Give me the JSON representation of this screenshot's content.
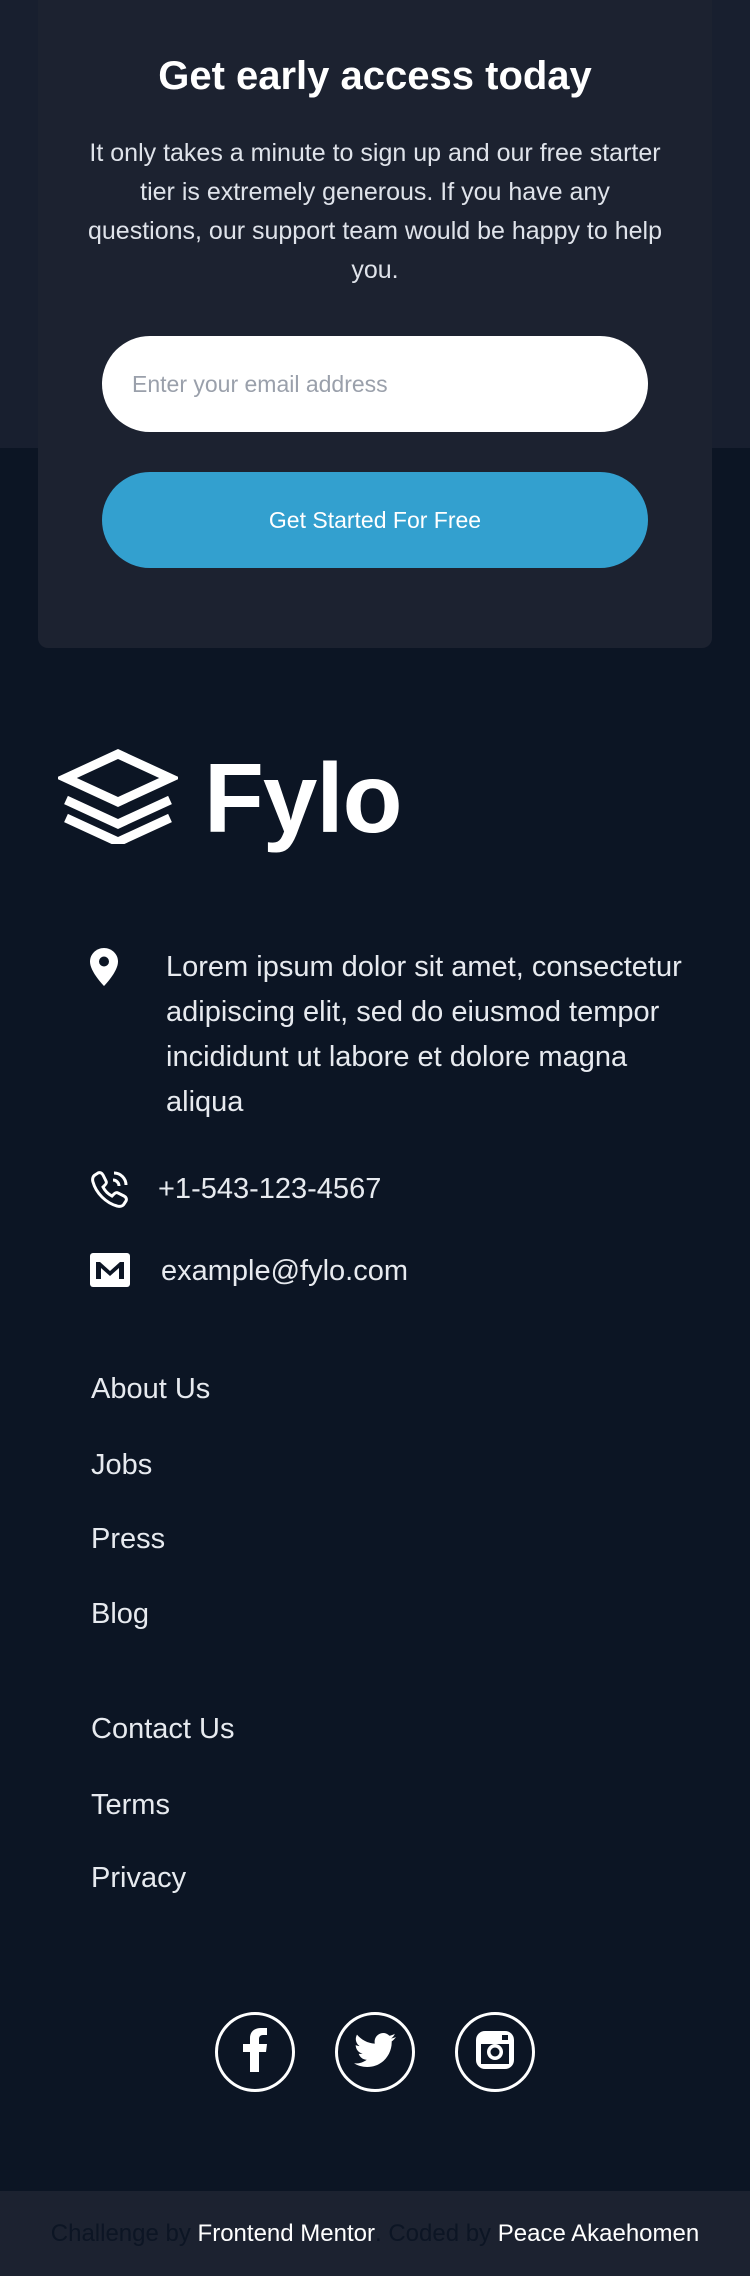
{
  "cta": {
    "title": "Get early access today",
    "text": "It only takes a minute to sign up and our free starter tier is extremely generous. If you have any questions, our support team would be happy to help you.",
    "email_placeholder": "Enter your email address",
    "button_label": "Get Started For Free"
  },
  "footer": {
    "logo_text": "Fylo",
    "contact": {
      "address": "Lorem ipsum dolor sit amet, consectetur adipiscing elit, sed do eiusmod tempor incididunt ut labore et dolore magna aliqua",
      "phone": "+1-543-123-4567",
      "email": "example@fylo.com"
    },
    "links_primary": [
      "About Us",
      "Jobs",
      "Press",
      "Blog"
    ],
    "links_secondary": [
      "Contact Us",
      "Terms",
      "Privacy"
    ],
    "social": [
      "facebook-icon",
      "twitter-icon",
      "instagram-icon"
    ]
  },
  "attribution": {
    "challenge_prefix": "Challenge by",
    "challenge_link": "Frontend Mentor",
    "separator": ".",
    "coded_prefix": "Coded by",
    "coder_link": "Peace Akaehomen"
  },
  "colors": {
    "background": "#0c1524",
    "card": "#1c2230",
    "accent": "#33a0cf",
    "text": "#e7eaef"
  }
}
